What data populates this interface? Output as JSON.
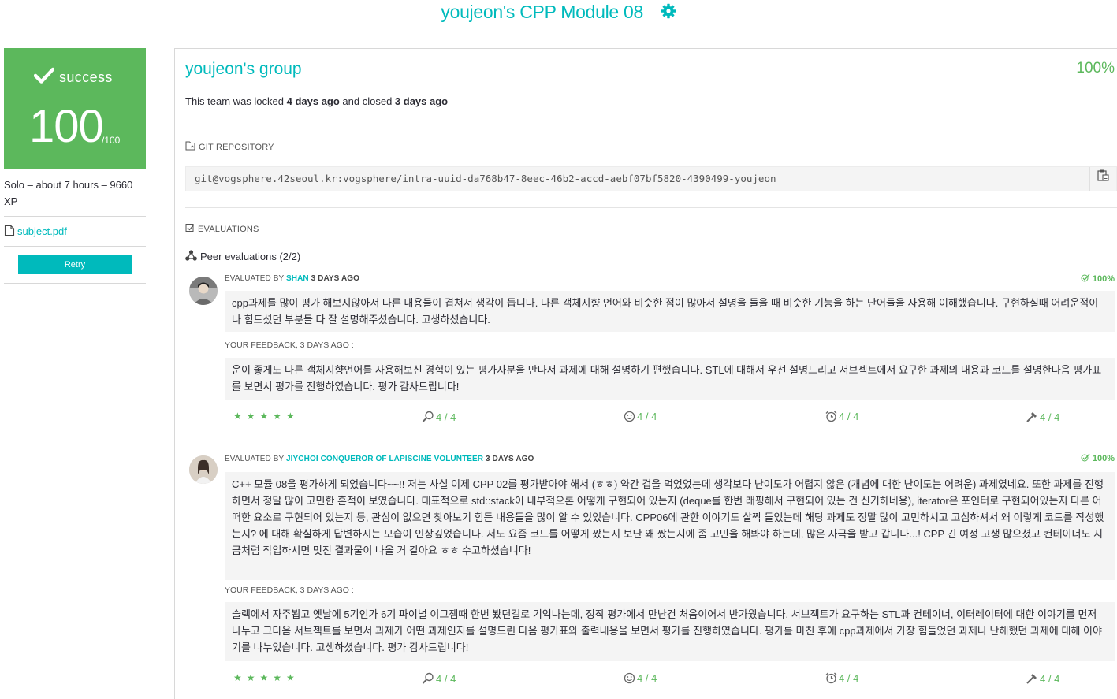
{
  "header": {
    "title": "youjeon's CPP Module 08",
    "settings_icon": "gear-icon"
  },
  "sidebar": {
    "status": "success",
    "score": "100",
    "score_max": "/100",
    "meta": "Solo – about 7 hours – 9660 XP",
    "subject_link": "subject.pdf",
    "retry_label": "Retry"
  },
  "team": {
    "name": "youjeon's group",
    "percent": "100%",
    "locked_prefix": "This team was locked ",
    "locked_when": "4 days ago",
    "closed_prefix": " and closed ",
    "closed_when": "3 days ago"
  },
  "repository": {
    "label": "GIT REPOSITORY",
    "url": "git@vogsphere.42seoul.kr:vogsphere/intra-uuid-da768b47-8eec-46b2-accd-aebf07bf5820-4390499-youjeon"
  },
  "evaluations": {
    "label": "EVALUATIONS",
    "peer_title": "Peer evaluations (2/2)",
    "items": [
      {
        "evaluated_by": "EVALUATED BY ",
        "evaluator": "SHAN",
        "when": " 3 DAYS AGO",
        "percent": "100%",
        "comment": "cpp과제를 많이 평가 해보지않아서 다른 내용들이 겹쳐서 생각이 듭니다. 다른 객체지향 언어와 비슷한 점이 많아서 설명을 들을 때 비슷한 기능을 하는 단어들을 사용해 이해했습니다. 구현하실때 어려운점이나 힘드셨던 부분들 다 잘 설명해주셨습니다. 고생하셨습니다.",
        "feedback_label": "YOUR FEEDBACK, 3 DAYS AGO :",
        "feedback": "운이 좋게도 다른 객체지향언어를 사용해보신 경험이 있는 평가자분을 만나서 과제에 대해 설명하기 편했습니다. STL에 대해서 우선 설명드리고 서브젝트에서 요구한 과제의 내용과 코드를 설명한다음 평가표를 보면서 평가를 진행하였습니다. 평가 감사드립니다!",
        "stars": "★★★★★",
        "metrics": [
          "4 / 4",
          "4 / 4",
          "4 / 4",
          "4 / 4"
        ]
      },
      {
        "evaluated_by": "EVALUATED BY ",
        "evaluator": "JIYCHOI CONQUEROR OF LAPISCINE VOLUNTEER",
        "when": " 3 DAYS AGO",
        "percent": "100%",
        "comment": "C++ 모듈 08을 평가하게 되었습니다~~!! 저는 사실 이제 CPP 02를 평가받아야 해서 (ㅎㅎ) 약간 겁을 먹었었는데 생각보다 난이도가 어렵지 않은 (개념에 대한 난이도는 어려운) 과제였네요. 또한 과제를 진행하면서 정말 많이 고민한 흔적이 보였습니다. 대표적으로 std::stack이 내부적으론 어떻게 구현되어 있는지 (deque를 한번 래핑해서 구현되어 있는 건 신기하네용), iterator은 포인터로 구현되어있는지 다른 어떠한 요소로 구현되어 있는지 등, 관심이 없으면 찾아보기 힘든 내용들을 많이 알 수 있었습니다. CPP06에 관한 이야기도 살짝 들었는데 해당 과제도 정말 많이 고민하시고 고심하셔서 왜 이렇게 코드를 작성했는지? 에 대해 확실하게 답변하시는 모습이 인상깊었습니다. 저도 요즘 코드를 어떻게 짰는지 보단 왜 짰는지에 좀 고민을 해봐야 하는데, 많은 자극을 받고 갑니다...! CPP 긴 여정 고생 많으셨고 컨테이너도 지금처럼 작업하시면 멋진 결과물이 나올 거 같아요 ㅎㅎ 수고하셨습니다!",
        "feedback_label": "YOUR FEEDBACK, 3 DAYS AGO :",
        "feedback": "슬랙에서 자주뵙고 옛날에 5기인가 6기 파이널 이그잼때 한번 봤던걸로 기억나는데, 정작 평가에서 만난건 처음이어서 반가웠습니다. 서브젝트가 요구하는 STL과 컨테이너, 이터레이터에 대한 이야기를 먼저 나누고 그다음 서브젝트를 보면서 과제가 어떤 과제인지를 설명드린 다음 평가표와 출력내용을 보면서 평가를 진행하였습니다. 평가를 마친 후에 cpp과제에서 가장 힘들었던 과제나 난해했던 과제에 대해 이야기를 나누었습니다. 고생하셨습니다. 평가 감사드립니다!",
        "stars": "★★★★★",
        "metrics": [
          "4 / 4",
          "4 / 4",
          "4 / 4",
          "4 / 4"
        ]
      }
    ]
  },
  "colors": {
    "accent": "#00babc",
    "success": "#5cb85c",
    "bubble_bg": "#f4f4f4"
  },
  "icons": [
    "gear-icon",
    "checkmark-icon",
    "file-icon",
    "git-icon",
    "clipboard-icon",
    "checkbox-icon",
    "network-icon",
    "check-icon",
    "star-icon",
    "search-person-icon",
    "smiley-icon",
    "alarm-clock-icon",
    "hammer-icon"
  ]
}
